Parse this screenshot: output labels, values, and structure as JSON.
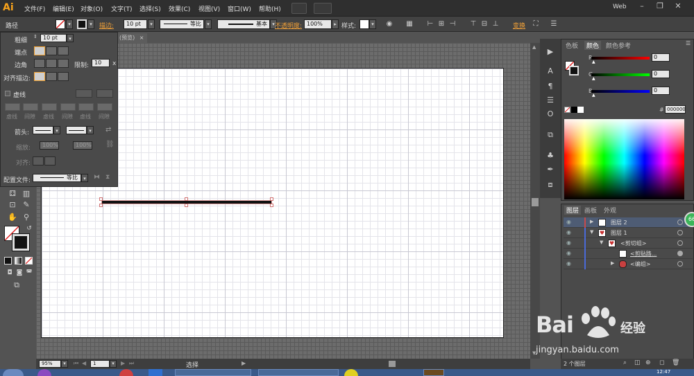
{
  "app": {
    "logo": "Ai",
    "workspace": "Web"
  },
  "menu": [
    "文件(F)",
    "编辑(E)",
    "对象(O)",
    "文字(T)",
    "选择(S)",
    "效果(C)",
    "视图(V)",
    "窗口(W)",
    "帮助(H)"
  ],
  "controlbar": {
    "selection_type": "路径",
    "stroke_label": "描边:",
    "stroke_weight": "10 pt",
    "profile_label": "等比",
    "brush_label": "基本",
    "opacity_label": "不透明度:",
    "opacity_value": "100%",
    "style_label": "样式:",
    "transform_label": "变换"
  },
  "stroke_panel": {
    "weight_label": "粗细",
    "weight_value": "10 pt",
    "cap_label": "端点",
    "corner_label": "边角",
    "limit_label": "限制:",
    "limit_value": "10",
    "limit_unit": "x",
    "align_label": "对齐描边:",
    "dashed_label": "虚线",
    "dash_labels": [
      "虚线",
      "间隙",
      "虚线",
      "间隙",
      "虚线",
      "间隙"
    ],
    "arrow_label": "箭头:",
    "scale_label": "缩放:",
    "scale_start": "100%",
    "scale_end": "100%",
    "align_arrow_label": "对齐:",
    "profile_label": "配置文件:",
    "profile_value": "等比"
  },
  "document_tab": "(预览)",
  "status": {
    "zoom": "95%",
    "page": "1",
    "tool_status": "选择"
  },
  "color_panel": {
    "tabs": [
      "色板",
      "颜色",
      "颜色参考"
    ],
    "active_tab": "颜色",
    "r_label": "R",
    "g_label": "G",
    "b_label": "B",
    "r_value": "0",
    "g_value": "0",
    "b_value": "0",
    "hex_label": "#",
    "hex_value": "000000"
  },
  "layers_panel": {
    "tabs": [
      "图层",
      "画板",
      "外观"
    ],
    "active_tab": "图层",
    "rows": [
      {
        "name": "图层 2"
      },
      {
        "name": "图层 1"
      },
      {
        "name": "<剪切组>"
      },
      {
        "name": "<剪贴路..."
      },
      {
        "name": "<编组>"
      }
    ],
    "footer": "2 个图层"
  },
  "watermark": {
    "brand": "Bai",
    "brand2": "经验",
    "url": "jingyan.baidu.com"
  },
  "badge": "66",
  "clock": "12:47",
  "colors": {
    "accent_orange": "#f0a038",
    "selection_red": "#d07070",
    "layer_blue": "#4a6ad8"
  }
}
